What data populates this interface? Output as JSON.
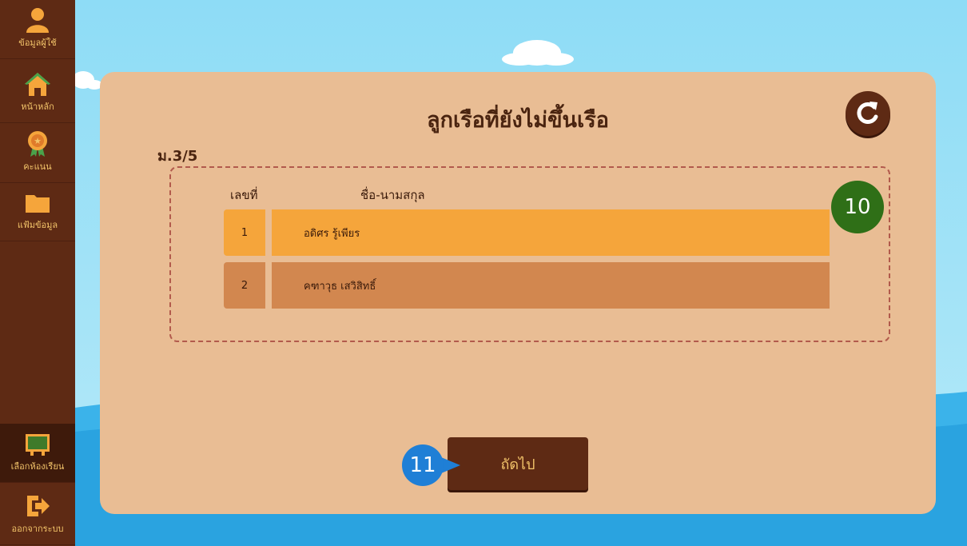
{
  "sidebar": {
    "items": [
      {
        "label": "ข้อมูลผู้ใช้",
        "icon": "user-icon"
      },
      {
        "label": "หน้าหลัก",
        "icon": "home-icon"
      },
      {
        "label": "คะแนน",
        "icon": "medal-icon"
      },
      {
        "label": "แฟ้มข้อมูล",
        "icon": "folder-icon"
      },
      {
        "label": "เลือกห้องเรียน",
        "icon": "classroom-board-icon"
      },
      {
        "label": "ออกจากระบบ",
        "icon": "logout-icon"
      }
    ]
  },
  "panel": {
    "title": "ลูกเรือที่ยังไม่ขึ้นเรือ",
    "class_name": "ม.3/5",
    "headers": {
      "number": "เลขที่",
      "name": "ชื่อ-นามสกุล"
    },
    "rows": [
      {
        "number": "1",
        "name": "อดิศร รู้เพียร"
      },
      {
        "number": "2",
        "name": "คฑาวุธ เสวิสิทธิ์"
      }
    ],
    "next_label": "ถัดไป"
  },
  "markers": {
    "list": "10",
    "next": "11"
  },
  "colors": {
    "sidebar": "#5e2a14",
    "panel": "#e9bd94",
    "row_highlight": "#f5a53b",
    "row_normal": "#d2874f",
    "marker_green": "#2f6f17",
    "marker_blue": "#1f7fd6"
  }
}
